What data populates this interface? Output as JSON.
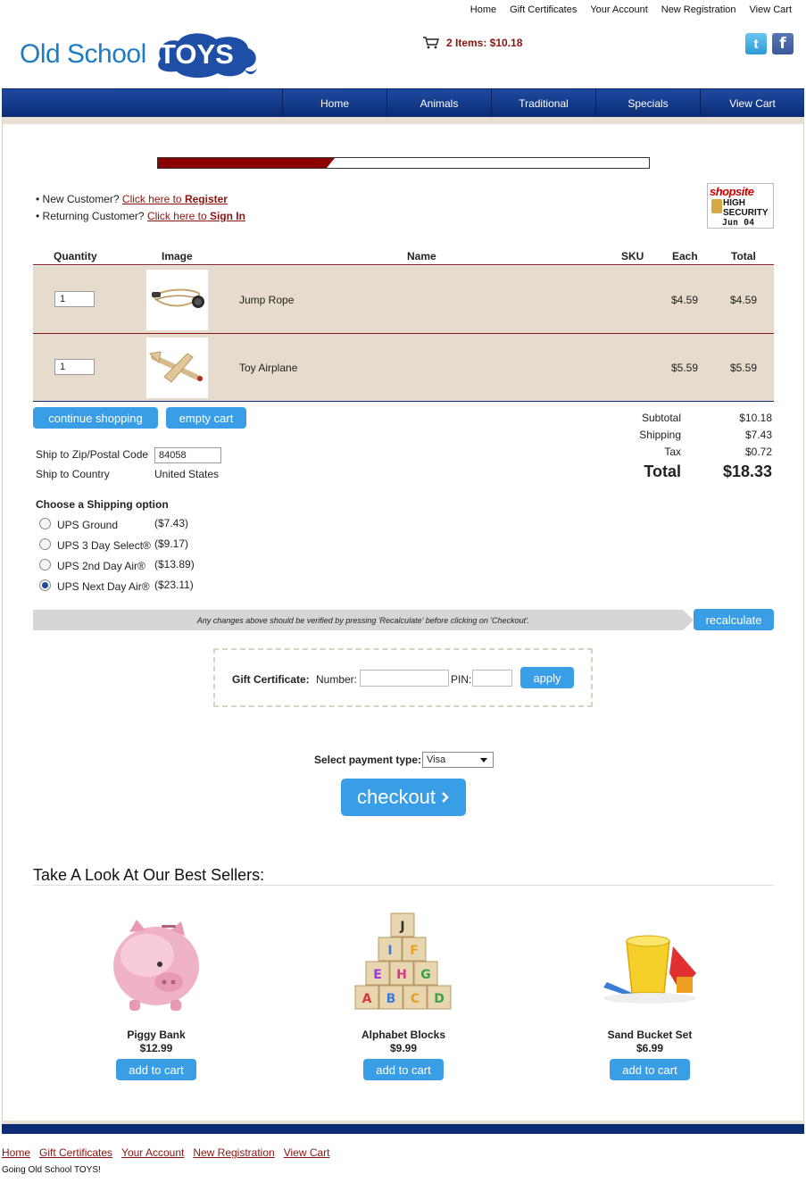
{
  "top_nav": [
    "Home",
    "Gift Certificates",
    "Your Account",
    "New Registration",
    "View Cart"
  ],
  "logo": {
    "word1": "Old School",
    "word2": "TOYS"
  },
  "cart_summary": "2 Items: $10.18",
  "main_nav": [
    "Home",
    "Animals",
    "Traditional",
    "Specials",
    "View Cart"
  ],
  "progress": {
    "fraction": 0.36
  },
  "login": {
    "new_prefix": "• New Customer?",
    "new_link_text": "Click here to ",
    "new_link_bold": "Register",
    "ret_prefix": "• Returning Customer?",
    "ret_link_text": "Click here to ",
    "ret_link_bold": "Sign In"
  },
  "badge": {
    "brand": "shopsite",
    "line1": "HIGH",
    "line2": "SECURITY",
    "date": "Jun 04"
  },
  "cart_headers": {
    "quantity": "Quantity",
    "image": "Image",
    "name": "Name",
    "sku": "SKU",
    "each": "Each",
    "total": "Total"
  },
  "cart_items": [
    {
      "qty": "1",
      "name": "Jump Rope",
      "each": "$4.59",
      "total": "$4.59"
    },
    {
      "qty": "1",
      "name": "Toy Airplane",
      "each": "$5.59",
      "total": "$5.59"
    }
  ],
  "buttons": {
    "continue": "continue shopping",
    "empty": "empty cart",
    "recalculate": "recalculate",
    "apply": "apply",
    "checkout": "checkout",
    "add_to_cart": "add to cart"
  },
  "totals": {
    "subtotal_label": "Subtotal",
    "subtotal": "$10.18",
    "shipping_label": "Shipping",
    "shipping": "$7.43",
    "tax_label": "Tax",
    "tax": "$0.72",
    "total_label": "Total",
    "total": "$18.33"
  },
  "shipping_form": {
    "zip_label": "Ship to Zip/Postal Code",
    "zip_value": "84058",
    "country_label": "Ship to Country",
    "country_value": "United States"
  },
  "shipping_options_title": "Choose a Shipping option",
  "shipping_options": [
    {
      "label": "UPS Ground",
      "price": "($7.43)",
      "selected": false
    },
    {
      "label": "UPS 3 Day Select®",
      "price": "($9.17)",
      "selected": false
    },
    {
      "label": "UPS 2nd Day Air®",
      "price": "($13.89)",
      "selected": false
    },
    {
      "label": "UPS Next Day Air®",
      "price": "($23.11)",
      "selected": true
    }
  ],
  "recalc_note": "Any changes above should be verified by pressing 'Recalculate' before clicking on 'Checkout'.",
  "gift": {
    "label": "Gift Certificate:",
    "number_label": "Number:",
    "pin_label": "PIN:"
  },
  "payment": {
    "label": "Select payment type:",
    "selected": "Visa"
  },
  "best_sellers": {
    "title": "Take A Look At Our Best Sellers:",
    "items": [
      {
        "name": "Piggy Bank",
        "price": "$12.99"
      },
      {
        "name": "Alphabet Blocks",
        "price": "$9.99"
      },
      {
        "name": "Sand Bucket Set",
        "price": "$6.99"
      }
    ]
  },
  "footer_links": [
    "Home",
    "Gift Certificates",
    "Your Account",
    "New Registration",
    "View Cart"
  ],
  "tagline": "Going Old School TOYS!",
  "colors": {
    "brand_blue": "#1d7cc2",
    "nav_blue": "#0c2c74",
    "button_blue": "#3a9ee6",
    "link_red": "#8b1410",
    "row_tan": "#e6dccd"
  }
}
